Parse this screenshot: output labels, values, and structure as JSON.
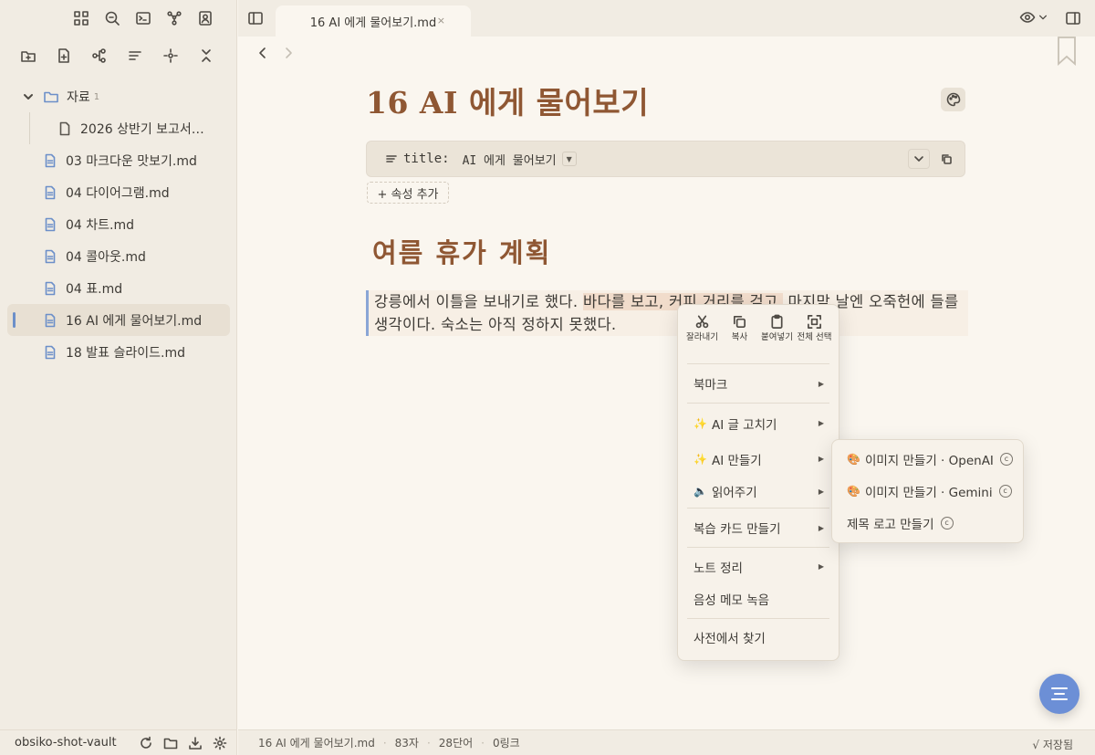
{
  "sidebar": {
    "top_icons": [
      "grid-icon",
      "search-icon",
      "terminal-icon",
      "graph-icon",
      "contact-icon"
    ],
    "action_icons": [
      "new-folder-icon",
      "new-file-icon",
      "outline-icon",
      "sort-icon",
      "locate-icon",
      "collapse-icon"
    ],
    "folder": {
      "label": "자료",
      "count": "1"
    },
    "nested_files": [
      "2026 상반기 보고서…"
    ],
    "files": [
      "03 마크다운 맛보기.md",
      "04 다이어그램.md",
      "04 차트.md",
      "04 콜아웃.md",
      "04 표.md",
      "16 AI 에게 물어보기.md",
      "18 발표 슬라이드.md"
    ],
    "active_file": "16 AI 에게 물어보기.md",
    "vault_name": "obsiko-shot-vault"
  },
  "tab": {
    "title": "16 AI 에게 물어보기.md",
    "close": "×"
  },
  "editor": {
    "title": "16 AI 에게 물어보기",
    "property": {
      "key": "title:",
      "value": "AI 에게 물어보기"
    },
    "add_property": "+ 속성 추가",
    "heading": "여름 휴가 계획",
    "paragraph": {
      "before": "강릉에서 이틀을 보내기로 했다. ",
      "highlight": "바다를 보고, 커피 거리를 걷고,",
      "after": " 마지막 날엔 오죽헌에 들를 생각이다. 숙소는 아직 정하지 못했다."
    }
  },
  "context_menu": {
    "clipboard": [
      {
        "label": "잘라내기",
        "icon": "scissors-icon"
      },
      {
        "label": "복사",
        "icon": "copy-icon"
      },
      {
        "label": "붙여넣기",
        "icon": "paste-icon"
      },
      {
        "label": "전체 선택",
        "icon": "select-all-icon"
      }
    ],
    "bookmark": "북마크",
    "ai_fix": "AI 글 고치기",
    "ai_create": "AI 만들기",
    "read_aloud": "읽어주기",
    "flashcards": "복습 카드 만들기",
    "note_cleanup": "노트 정리",
    "voice_memo": "음성 메모 녹음",
    "dictionary": "사전에서 찾기",
    "sparkle": "✨",
    "speaker": "🔈"
  },
  "submenu": {
    "items": [
      {
        "emoji": "🎨",
        "label": "이미지 만들기 · OpenAI",
        "badge": "c"
      },
      {
        "emoji": "🎨",
        "label": "이미지 만들기 · Gemini",
        "badge": "c"
      },
      {
        "emoji": "",
        "label": "제목 로고 만들기",
        "badge": "c"
      }
    ]
  },
  "statusbar": {
    "file": "16 AI 에게 물어보기.md",
    "chars": "83자",
    "words": "28단어",
    "links": "0링크",
    "saved": "√ 저장됨"
  },
  "colors": {
    "accent": "#8f5733",
    "link_blue": "#6c8fc9",
    "fab": "#6c8fd6",
    "background": "#faf6ef",
    "sidebar": "#f1ece3"
  }
}
